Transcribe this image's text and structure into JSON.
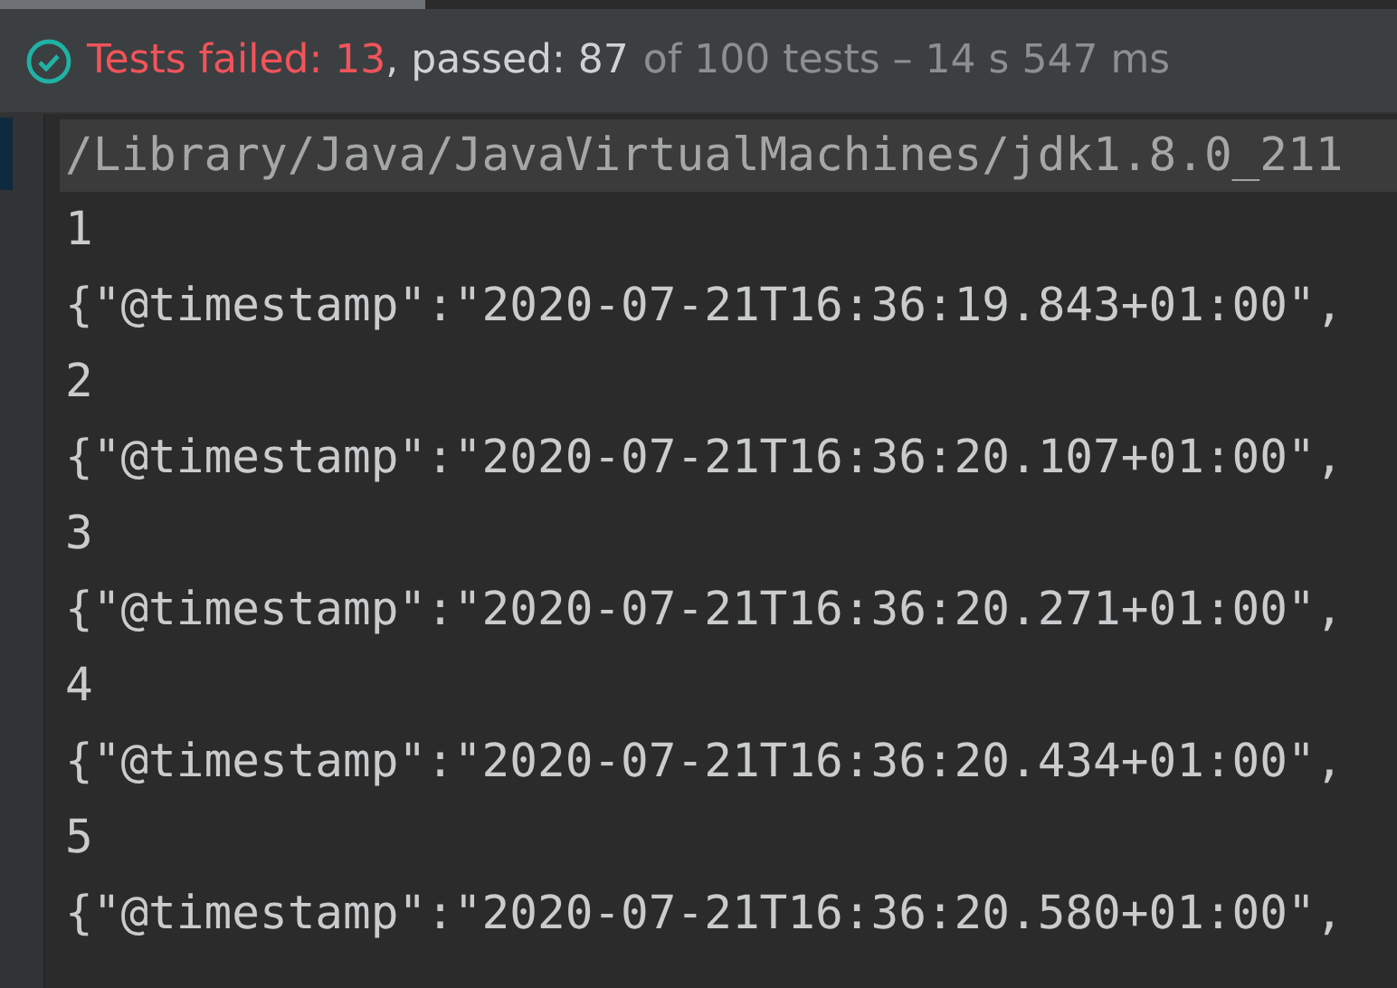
{
  "status_bar": {
    "failed": "Tests failed: 13",
    "passed": ", passed: 87",
    "summary": "of 100 tests – 14 s 547 ms"
  },
  "console": {
    "command": "/Library/Java/JavaVirtualMachines/jdk1.8.0_211",
    "lines": [
      "1",
      "{\"@timestamp\":\"2020-07-21T16:36:19.843+01:00\",",
      "2",
      "{\"@timestamp\":\"2020-07-21T16:36:20.107+01:00\",",
      "3",
      "{\"@timestamp\":\"2020-07-21T16:36:20.271+01:00\",",
      "4",
      "{\"@timestamp\":\"2020-07-21T16:36:20.434+01:00\",",
      "5",
      "{\"@timestamp\":\"2020-07-21T16:36:20.580+01:00\","
    ]
  }
}
